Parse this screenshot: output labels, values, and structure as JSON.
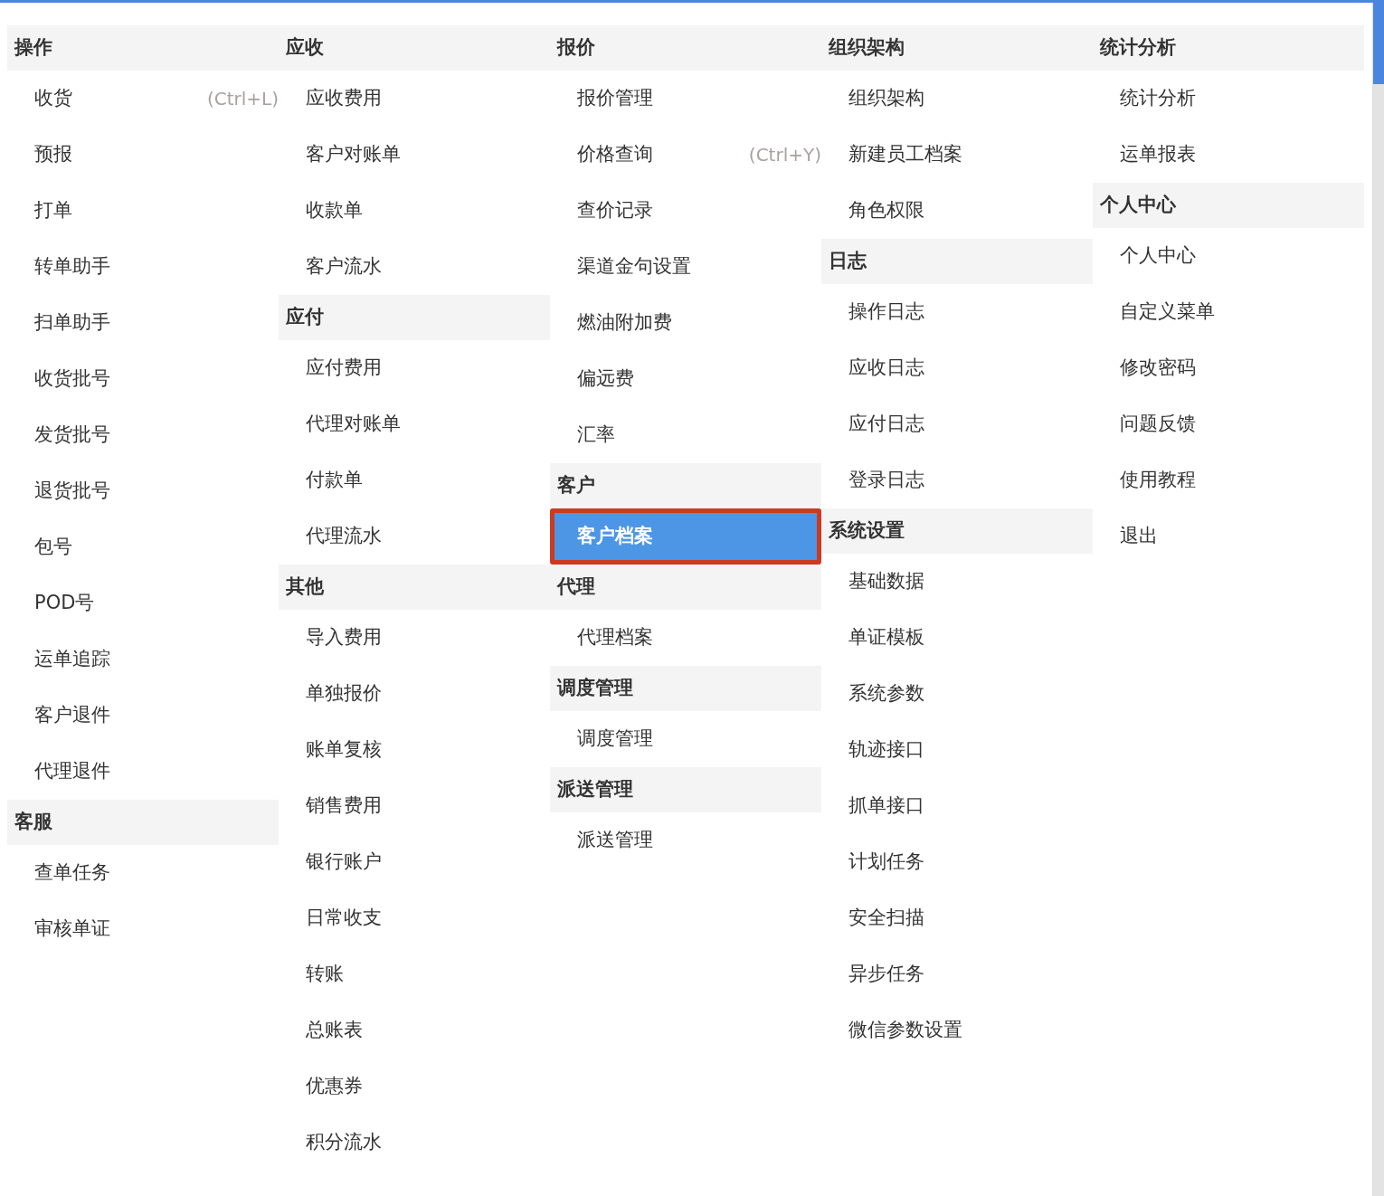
{
  "menu_columns": [
    {
      "sections": [
        {
          "title": "操作",
          "items": [
            {
              "label": "收货",
              "shortcut": "(Ctrl+L)",
              "selected": false
            },
            {
              "label": "预报",
              "selected": false
            },
            {
              "label": "打单",
              "selected": false
            },
            {
              "label": "转单助手",
              "selected": false
            },
            {
              "label": "扫单助手",
              "selected": false
            },
            {
              "label": "收货批号",
              "selected": false
            },
            {
              "label": "发货批号",
              "selected": false
            },
            {
              "label": "退货批号",
              "selected": false
            },
            {
              "label": "包号",
              "selected": false
            },
            {
              "label": "POD号",
              "selected": false
            },
            {
              "label": "运单追踪",
              "selected": false
            },
            {
              "label": "客户退件",
              "selected": false
            },
            {
              "label": "代理退件",
              "selected": false
            }
          ]
        },
        {
          "title": "客服",
          "items": [
            {
              "label": "查单任务",
              "selected": false
            },
            {
              "label": "审核单证",
              "selected": false
            }
          ]
        }
      ]
    },
    {
      "sections": [
        {
          "title": "应收",
          "items": [
            {
              "label": "应收费用",
              "selected": false
            },
            {
              "label": "客户对账单",
              "selected": false
            },
            {
              "label": "收款单",
              "selected": false
            },
            {
              "label": "客户流水",
              "selected": false
            }
          ]
        },
        {
          "title": "应付",
          "items": [
            {
              "label": "应付费用",
              "selected": false
            },
            {
              "label": "代理对账单",
              "selected": false
            },
            {
              "label": "付款单",
              "selected": false
            },
            {
              "label": "代理流水",
              "selected": false
            }
          ]
        },
        {
          "title": "其他",
          "items": [
            {
              "label": "导入费用",
              "selected": false
            },
            {
              "label": "单独报价",
              "selected": false
            },
            {
              "label": "账单复核",
              "selected": false
            },
            {
              "label": "销售费用",
              "selected": false
            },
            {
              "label": "银行账户",
              "selected": false
            },
            {
              "label": "日常收支",
              "selected": false
            },
            {
              "label": "转账",
              "selected": false
            },
            {
              "label": "总账表",
              "selected": false
            },
            {
              "label": "优惠券",
              "selected": false
            },
            {
              "label": "积分流水",
              "selected": false
            }
          ]
        }
      ]
    },
    {
      "sections": [
        {
          "title": "报价",
          "items": [
            {
              "label": "报价管理",
              "selected": false
            },
            {
              "label": "价格查询",
              "shortcut": "(Ctrl+Y)",
              "selected": false
            },
            {
              "label": "查价记录",
              "selected": false
            },
            {
              "label": "渠道金句设置",
              "selected": false
            },
            {
              "label": "燃油附加费",
              "selected": false
            },
            {
              "label": "偏远费",
              "selected": false
            },
            {
              "label": "汇率",
              "selected": false
            }
          ]
        },
        {
          "title": "客户",
          "items": [
            {
              "label": "客户档案",
              "selected": true,
              "outlined": true
            }
          ]
        },
        {
          "title": "代理",
          "items": [
            {
              "label": "代理档案",
              "selected": false
            }
          ]
        },
        {
          "title": "调度管理",
          "items": [
            {
              "label": "调度管理",
              "selected": false
            }
          ]
        },
        {
          "title": "派送管理",
          "items": [
            {
              "label": "派送管理",
              "selected": false
            }
          ]
        }
      ]
    },
    {
      "sections": [
        {
          "title": "组织架构",
          "items": [
            {
              "label": "组织架构",
              "selected": false
            },
            {
              "label": "新建员工档案",
              "selected": false
            },
            {
              "label": "角色权限",
              "selected": false
            }
          ]
        },
        {
          "title": "日志",
          "items": [
            {
              "label": "操作日志",
              "selected": false
            },
            {
              "label": "应收日志",
              "selected": false
            },
            {
              "label": "应付日志",
              "selected": false
            },
            {
              "label": "登录日志",
              "selected": false
            }
          ]
        },
        {
          "title": "系统设置",
          "items": [
            {
              "label": "基础数据",
              "selected": false
            },
            {
              "label": "单证模板",
              "selected": false
            },
            {
              "label": "系统参数",
              "selected": false
            },
            {
              "label": "轨迹接口",
              "selected": false
            },
            {
              "label": "抓单接口",
              "selected": false
            },
            {
              "label": "计划任务",
              "selected": false
            },
            {
              "label": "安全扫描",
              "selected": false
            },
            {
              "label": "异步任务",
              "selected": false
            },
            {
              "label": "微信参数设置",
              "selected": false
            }
          ]
        }
      ]
    },
    {
      "sections": [
        {
          "title": "统计分析",
          "items": [
            {
              "label": "统计分析",
              "selected": false
            },
            {
              "label": "运单报表",
              "selected": false
            }
          ]
        },
        {
          "title": "个人中心",
          "items": [
            {
              "label": "个人中心",
              "selected": false
            },
            {
              "label": "自定义菜单",
              "selected": false
            },
            {
              "label": "修改密码",
              "selected": false
            },
            {
              "label": "问题反馈",
              "selected": false
            },
            {
              "label": "使用教程",
              "selected": false
            },
            {
              "label": "退出",
              "selected": false
            }
          ]
        }
      ]
    }
  ]
}
